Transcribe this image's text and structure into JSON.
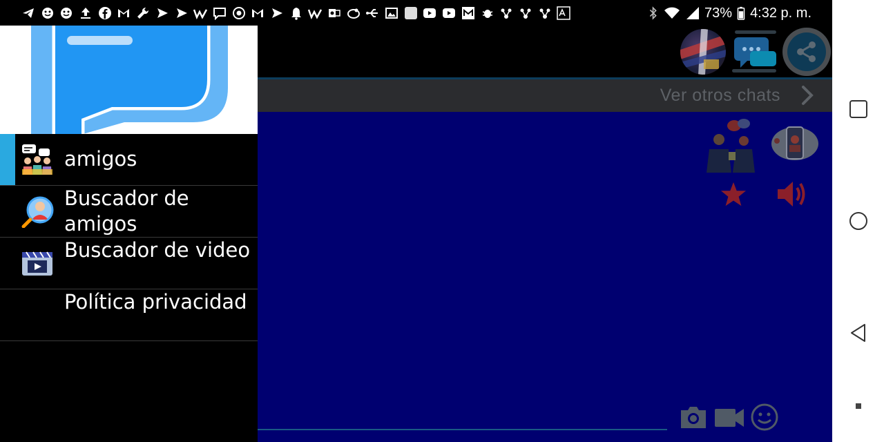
{
  "status_bar": {
    "battery": "73%",
    "time": "4:32 p. m.",
    "notification_icons": [
      "telegram-icon",
      "sticker-icon",
      "sticker-icon",
      "upload-icon",
      "facebook-icon",
      "gmail-icon",
      "wrench-icon",
      "send-icon",
      "send-icon",
      "w-icon",
      "chat-icon",
      "chrome-icon",
      "gmail-icon",
      "send-icon",
      "bell-icon",
      "w-icon",
      "outlook-icon",
      "mastodon-icon",
      "usb-icon",
      "image-icon",
      "blank-icon",
      "youtube-icon",
      "youtube-icon",
      "m-icon",
      "bug-icon",
      "molecule-icon",
      "molecule-icon",
      "molecule-icon",
      "translate-icon"
    ]
  },
  "drawer": {
    "items": [
      {
        "label": "amigos",
        "icon": "friends-chat-icon",
        "active": true
      },
      {
        "label": "Buscador de amigos",
        "icon": "friend-search-icon",
        "active": false
      },
      {
        "label": "Buscador de video",
        "icon": "video-clapper-icon",
        "active": false
      },
      {
        "label": "Política privacidad",
        "icon": "",
        "active": false
      }
    ]
  },
  "main": {
    "other_chats_label": "Ver otros chats"
  },
  "colors": {
    "accent": "#2aa9e0",
    "chat_background": "#000070",
    "bar_background": "#2b2c2f"
  }
}
